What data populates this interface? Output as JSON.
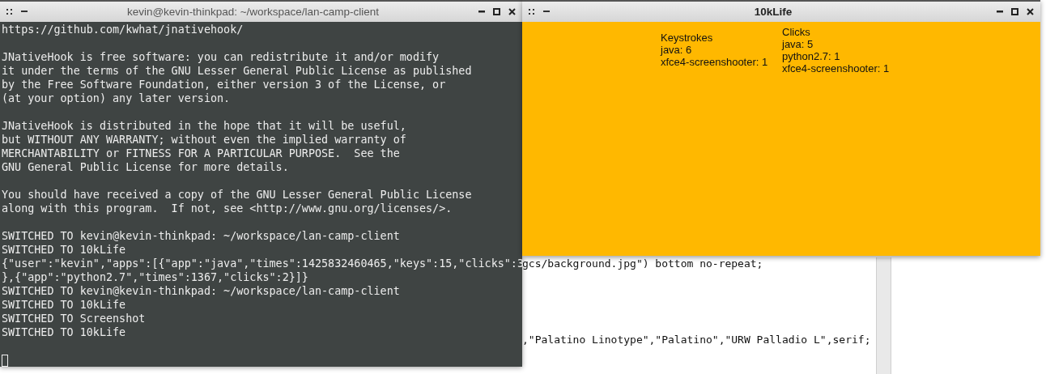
{
  "editor": {
    "lines": [
      "gcs/background.jpg\") bottom no-repeat;",
      ",\"Palatino Linotype\",\"Palatino\",\"URW Palladio L\",serif;"
    ]
  },
  "terminal": {
    "title": "kevin@kevin-thinkpad: ~/workspace/lan-camp-client",
    "focused": false,
    "cursor": true,
    "blocks": [
      [
        "https://github.com/kwhat/jnativehook/"
      ],
      [
        "JNativeHook is free software: you can redistribute it and/or modify",
        "it under the terms of the GNU Lesser General Public License as published",
        "by the Free Software Foundation, either version 3 of the License, or",
        "(at your option) any later version."
      ],
      [
        "JNativeHook is distributed in the hope that it will be useful,",
        "but WITHOUT ANY WARRANTY; without even the implied warranty of",
        "MERCHANTABILITY or FITNESS FOR A PARTICULAR PURPOSE.  See the",
        "GNU General Public License for more details."
      ],
      [
        "You should have received a copy of the GNU Lesser General Public License",
        "along with this program.  If not, see <http://www.gnu.org/licenses/>."
      ],
      [
        "SWITCHED TO kevin@kevin-thinkpad: ~/workspace/lan-camp-client",
        "SWITCHED TO 10kLife",
        "{\"user\":\"kevin\",\"apps\":[{\"app\":\"java\",\"times\":1425832460465,\"keys\":15,\"clicks\":3",
        "},{\"app\":\"python2.7\",\"times\":1367,\"clicks\":2}]}",
        "SWITCHED TO kevin@kevin-thinkpad: ~/workspace/lan-camp-client",
        "SWITCHED TO 10kLife",
        "SWITCHED TO Screenshot",
        "SWITCHED TO 10kLife"
      ]
    ]
  },
  "app": {
    "title": "10kLife",
    "focused": true,
    "panels": [
      {
        "heading": "Keystrokes",
        "entries": [
          "java: 6",
          "xfce4-screenshooter: 1"
        ]
      },
      {
        "heading": "Clicks",
        "entries": [
          "java: 5",
          "python2.7: 1",
          "xfce4-screenshooter: 1"
        ]
      }
    ]
  }
}
